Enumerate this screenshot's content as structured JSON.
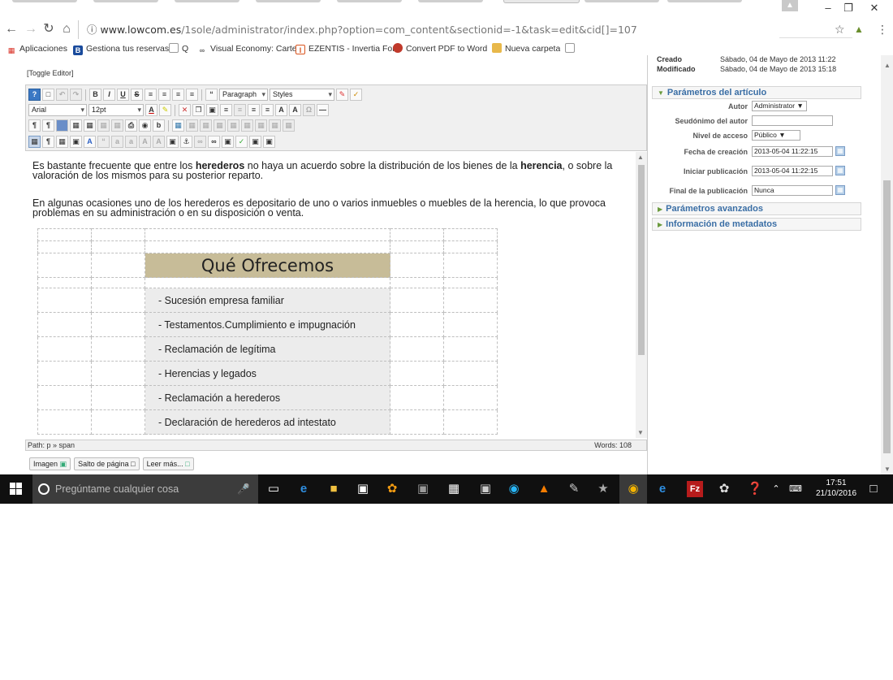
{
  "browser": {
    "url_scheme": "www.lowcom.es",
    "url_path": "/1sole/administrator/index.php?option=com_content&sectionid=-1&task=edit&cid[]=107",
    "info_icon": "info-icon"
  },
  "bookmarks": [
    {
      "label": "Aplicaciones",
      "icon": "apps-grid-icon",
      "color": "#d93025"
    },
    {
      "label": "Gestiona tus reservas",
      "icon": "booking-icon",
      "color": "#1a4b9c"
    },
    {
      "label": "Q",
      "icon": "page-icon",
      "color": "#888888"
    },
    {
      "label": "Visual Economy: Carte",
      "icon": "link-icon",
      "color": "#666666"
    },
    {
      "label": "EZENTIS - Invertia For",
      "icon": "bookmark-icon",
      "color": "#d9541e"
    },
    {
      "label": "Convert PDF to Word",
      "icon": "pdf-icon",
      "color": "#c0392b"
    },
    {
      "label": "Nueva carpeta",
      "icon": "folder-icon",
      "color": "#e8b84a"
    }
  ],
  "editor": {
    "toggle_label": "[Toggle Editor]",
    "font_name": "Arial",
    "font_size": "12pt",
    "format": "Paragraph",
    "styles": "Styles",
    "paragraph1_pre": "Es bastante frecuente que entre los ",
    "paragraph1_bold1": "herederos",
    "paragraph1_mid": " no haya un acuerdo sobre la distribución de los bienes de la ",
    "paragraph1_bold2": "herencia",
    "paragraph1_post": ", o sobre la valoración de los mismos para su posterior reparto.",
    "paragraph2": "En algunas ocasiones uno de los herederos es depositario de uno o varios inmuebles o muebles de la herencia, lo que provoca problemas en su administración o en su disposición o venta.",
    "table_heading": "Qué Ofrecemos",
    "items": [
      "- Sucesión empresa familiar",
      "- Testamentos.Cumplimiento e impugnación",
      "- Reclamación de legítima",
      "- Herencias y legados",
      "- Reclamación a herederos",
      "- Declaración de herederos ad intestato"
    ],
    "path": "Path: p » span",
    "words": "Words: 108",
    "buttons": [
      "Imagen",
      "Salto de página",
      "Leer más..."
    ]
  },
  "panel": {
    "created_label": "Creado",
    "created_value": "Sábado, 04 de Mayo de 2013 11:22",
    "modified_label": "Modificado",
    "modified_value": "Sábado, 04 de Mayo de 2013 15:18",
    "section_params": "Parámetros del artículo",
    "fields": [
      {
        "label": "Autor",
        "value": "Administrator ▼"
      },
      {
        "label": "Seudónimo del autor",
        "value": ""
      },
      {
        "label": "Nivel de acceso",
        "value": "Público ▼"
      },
      {
        "label": "Fecha de creación",
        "value": "2013-05-04 11:22:15"
      },
      {
        "label": "Iniciar publicación",
        "value": "2013-05-04 11:22:15"
      },
      {
        "label": "Final de la publicación",
        "value": "Nunca"
      }
    ],
    "section_advanced": "Parámetros avanzados",
    "section_metadata": "Información de metadatos"
  },
  "taskbar": {
    "search_placeholder": "Pregúntame cualquier cosa",
    "time": "17:51",
    "date": "21/10/2016"
  }
}
